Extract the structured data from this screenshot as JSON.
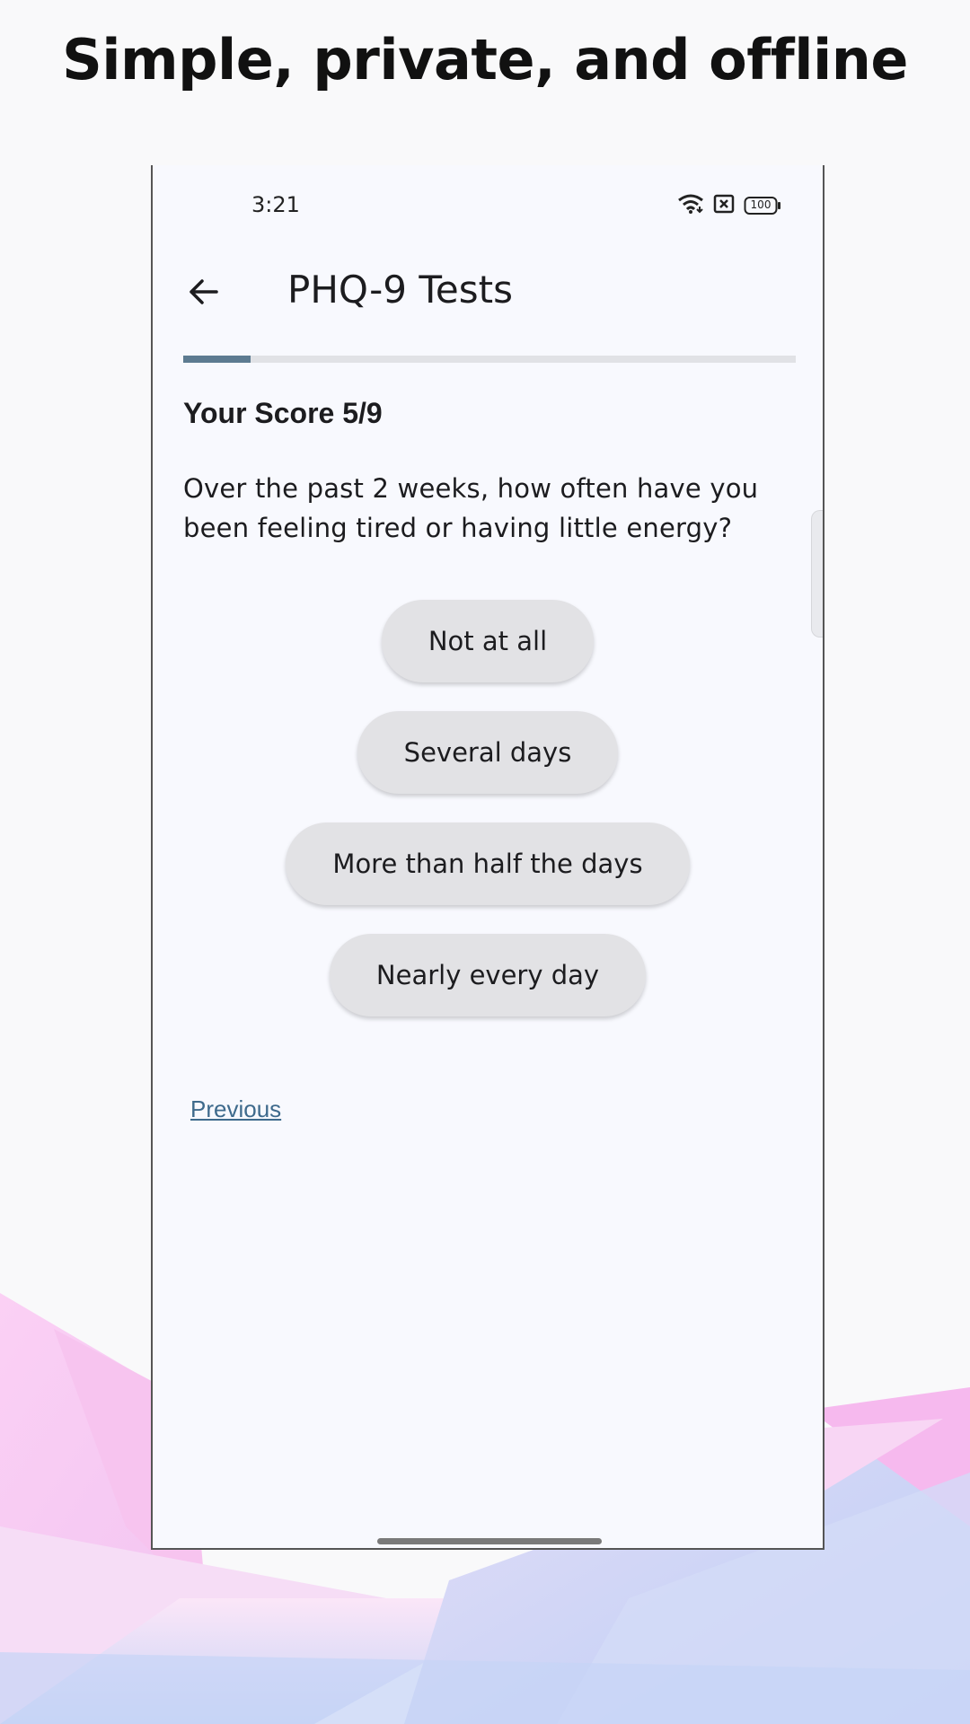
{
  "headline": "Simple, private, and offline",
  "status_bar": {
    "time": "3:21",
    "icons": [
      "wifi-icon",
      "no-sim-icon",
      "battery-icon"
    ],
    "battery_text": "100"
  },
  "app_bar": {
    "back_icon": "arrow-left-icon",
    "title": "PHQ-9 Tests"
  },
  "progress": {
    "fraction": 0.11,
    "fill_color": "#5d7b91",
    "track_color": "#e1e2e6"
  },
  "score_label": "Your Score 5/9",
  "question": "Over the past 2 weeks, how often have you been feeling tired or having little energy?",
  "options": [
    {
      "label": "Not at all"
    },
    {
      "label": "Several days"
    },
    {
      "label": "More than half the days"
    },
    {
      "label": "Nearly every day"
    }
  ],
  "previous_label": "Previous",
  "colors": {
    "background": "#f9f9fa",
    "phone_surface": "#f8f9fe",
    "button": "#e2e2e5",
    "link": "#3e6a8c"
  }
}
